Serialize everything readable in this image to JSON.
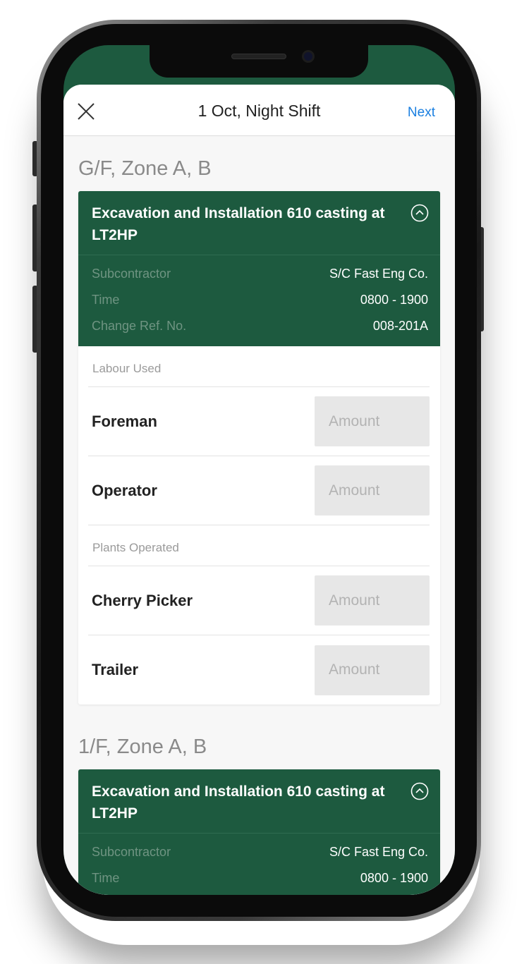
{
  "header": {
    "title": "1 Oct, Night Shift",
    "next_label": "Next"
  },
  "meta_labels": {
    "subcontractor": "Subcontractor",
    "time": "Time",
    "change_ref": "Change Ref. No."
  },
  "sections": [
    {
      "title": "G/F, Zone A, B",
      "card_title": "Excavation and Installation 610 casting at LT2HP",
      "subcontractor": "S/C Fast Eng Co.",
      "time": "0800 - 1900",
      "change_ref": "008-201A",
      "labour_label": "Labour Used",
      "labour": [
        {
          "name": "Foreman",
          "placeholder": "Amount"
        },
        {
          "name": "Operator",
          "placeholder": "Amount"
        }
      ],
      "plants_label": "Plants Operated",
      "plants": [
        {
          "name": "Cherry Picker",
          "placeholder": "Amount"
        },
        {
          "name": "Trailer",
          "placeholder": "Amount"
        }
      ]
    },
    {
      "title": "1/F, Zone A, B",
      "card_title": "Excavation and Installation 610 casting at LT2HP",
      "subcontractor": "S/C Fast Eng Co.",
      "time": "0800 - 1900"
    }
  ],
  "icons": {
    "close": "close-icon",
    "collapse": "chevron-up-circle-icon"
  },
  "colors": {
    "primary_green": "#1d5a3f",
    "link_blue": "#1a7fe0",
    "meta_label": "#6f9482",
    "input_bg": "#e7e7e7"
  }
}
